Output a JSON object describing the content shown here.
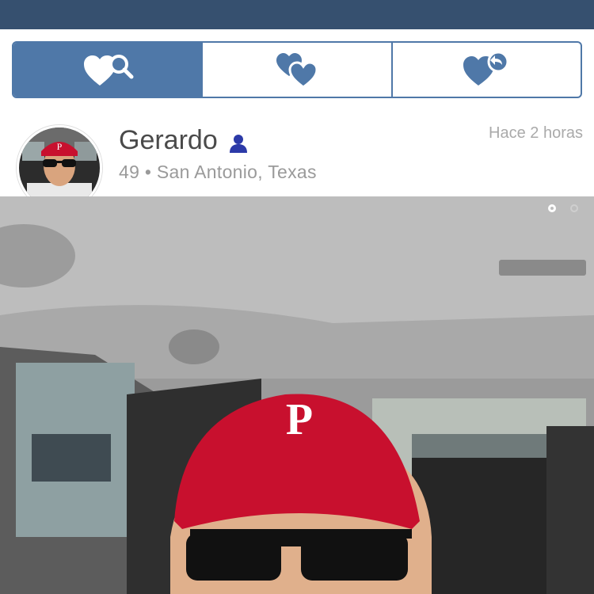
{
  "header": {
    "bar_color": "#36506f"
  },
  "tabs": [
    {
      "icon": "heart-search-icon",
      "active": true
    },
    {
      "icon": "two-hearts-icon",
      "active": false
    },
    {
      "icon": "heart-reply-icon",
      "active": false
    }
  ],
  "profile": {
    "name": "Gerardo",
    "age_location": "49 • San Antonio, Texas",
    "time_ago": "Hace 2 horas",
    "verified_icon": "person-icon"
  },
  "gallery": {
    "photo_count": 2,
    "current_index": 1
  },
  "colors": {
    "accent": "#4f78a8",
    "person_icon": "#2c3aa8"
  }
}
